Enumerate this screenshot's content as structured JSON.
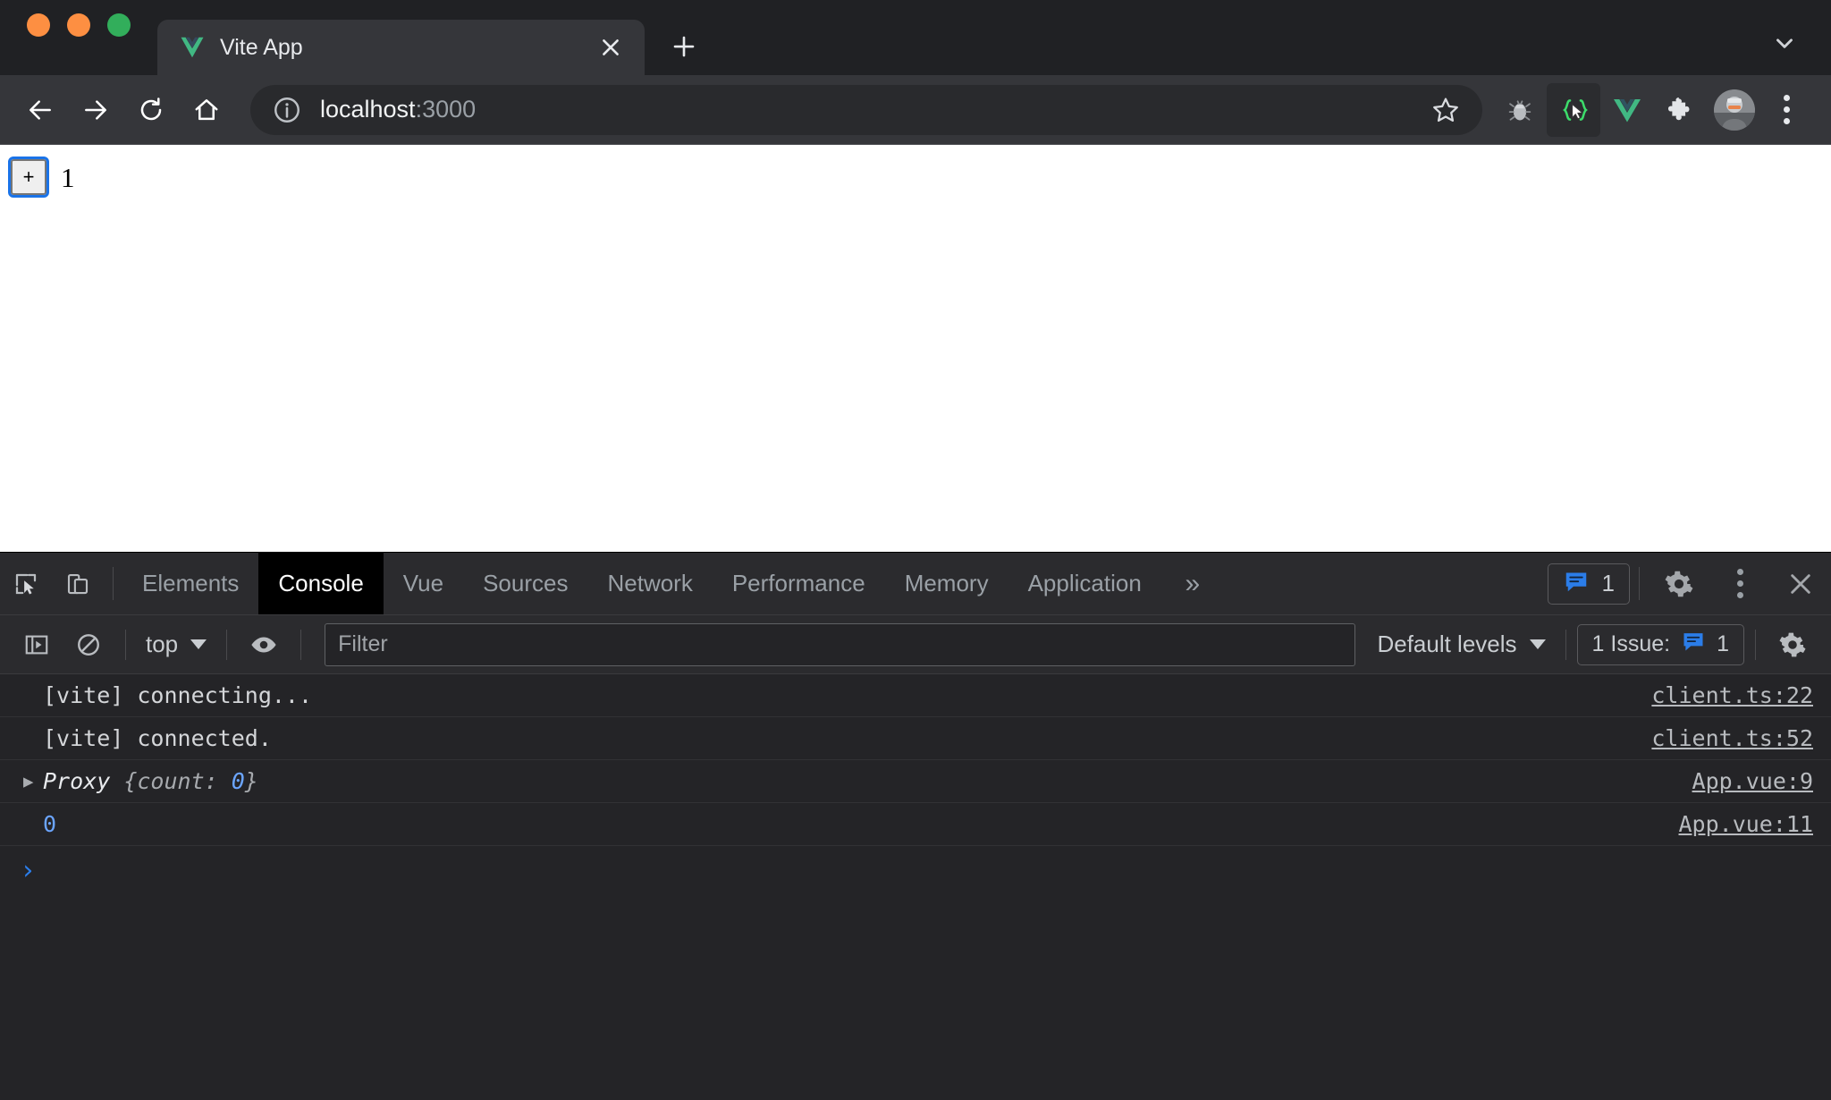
{
  "window": {
    "traffic_lights": [
      "close",
      "minimize",
      "maximize"
    ],
    "colors": {
      "close": "#fd8f42",
      "minimize": "#fd8f42",
      "maximize": "#32ae5b",
      "accent_blue": "#1a73e8",
      "devtools_bg": "#242427",
      "toolbar_bg": "#35363a"
    }
  },
  "tabs": [
    {
      "title": "Vite App",
      "favicon": "vue-logo-icon",
      "active": true
    }
  ],
  "tabstrip": {
    "new_tab_label": "+",
    "close_label": "×",
    "search_tabs_label": "Search tabs"
  },
  "toolbar": {
    "back_label": "Back",
    "forward_label": "Forward",
    "reload_label": "Reload",
    "home_label": "Home",
    "url_host": "localhost",
    "url_port": ":3000",
    "url_full": "localhost:3000",
    "site_info_label": "View site information",
    "bookmark_label": "Bookmark this tab",
    "extensions": [
      {
        "name": "bug-icon",
        "label": "Bug extension"
      },
      {
        "name": "code-cursor-icon",
        "label": "Code selector extension",
        "active": true
      },
      {
        "name": "vue-devtools-icon",
        "label": "Vue.js devtools"
      },
      {
        "name": "puzzle-icon",
        "label": "Extensions"
      }
    ],
    "profile_label": "Profile",
    "menu_label": "Customize and control Google Chrome"
  },
  "page": {
    "button_label": "+",
    "counter_value": "1"
  },
  "devtools": {
    "inspect_label": "Inspect element",
    "device_label": "Toggle device toolbar",
    "tabs": [
      {
        "label": "Elements",
        "selected": false
      },
      {
        "label": "Console",
        "selected": true
      },
      {
        "label": "Vue",
        "selected": false
      },
      {
        "label": "Sources",
        "selected": false
      },
      {
        "label": "Network",
        "selected": false
      },
      {
        "label": "Performance",
        "selected": false
      },
      {
        "label": "Memory",
        "selected": false
      },
      {
        "label": "Application",
        "selected": false
      }
    ],
    "more_tabs_label": "»",
    "issues_badge": {
      "icon": "issue-message-icon",
      "count": "1"
    },
    "settings_label": "Settings",
    "more_options_label": "More options",
    "close_label": "Close DevTools"
  },
  "console_toolbar": {
    "sidebar_toggle_label": "Show console sidebar",
    "clear_label": "Clear console",
    "context_selector": "top",
    "live_expression_label": "Create live expression",
    "filter_placeholder": "Filter",
    "filter_value": "",
    "levels_selector": "Default levels",
    "issues_text": "1 Issue:",
    "issues_count": "1",
    "console_settings_label": "Console settings"
  },
  "console_logs": [
    {
      "arrow": "",
      "message": "[vite] connecting...",
      "source": "client.ts:22",
      "type": "log"
    },
    {
      "arrow": "",
      "message": "[vite] connected.",
      "source": "client.ts:52",
      "type": "log"
    },
    {
      "arrow": "▶",
      "message": "Proxy {count: 0}",
      "object_name": "Proxy",
      "object_body_prefix": " {count: ",
      "object_body_value": "0",
      "object_body_suffix": "}",
      "source": "App.vue:9",
      "type": "object"
    },
    {
      "arrow": "",
      "message": "0",
      "source": "App.vue:11",
      "type": "number"
    }
  ],
  "console_prompt": {
    "caret": "›",
    "input_value": ""
  }
}
